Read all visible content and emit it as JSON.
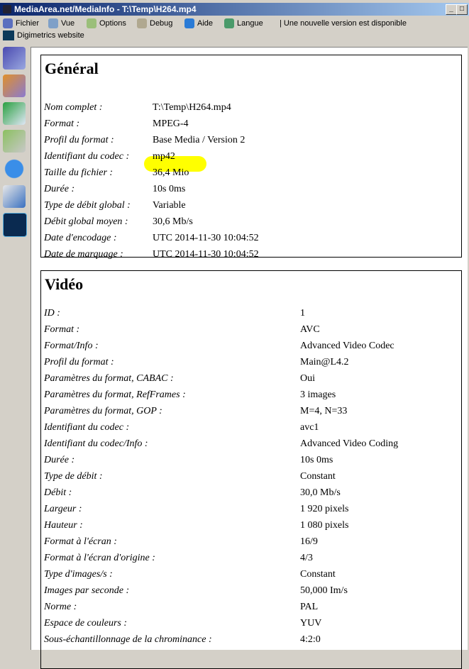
{
  "window": {
    "title": "MediaArea.net/MediaInfo - T:\\Temp\\H264.mp4",
    "minimize": "_",
    "maximize": "□"
  },
  "menu": [
    {
      "label": "Fichier",
      "icon": "file-icon",
      "color": "#5b6fbf"
    },
    {
      "label": "Vue",
      "icon": "view-icon",
      "color": "#7fa0c8"
    },
    {
      "label": "Options",
      "icon": "options-icon",
      "color": "#9bbf7a"
    },
    {
      "label": "Debug",
      "icon": "debug-icon",
      "color": "#b0a890"
    },
    {
      "label": "Aide",
      "icon": "help-icon",
      "color": "#2a7bd6"
    },
    {
      "label": "Langue",
      "icon": "globe-icon",
      "color": "#4a9a6a"
    }
  ],
  "update_notice": "| Une nouvelle version est disponible",
  "digimetrics": "Digimetrics website",
  "general": {
    "title": "Général",
    "rows": [
      [
        "Nom complet :",
        "T:\\Temp\\H264.mp4"
      ],
      [
        "Format :",
        "MPEG-4"
      ],
      [
        "Profil du format :",
        "Base Media / Version 2"
      ],
      [
        "Identifiant du codec :",
        "mp42"
      ],
      [
        "Taille du fichier :",
        "36,4 Mio"
      ],
      [
        "Durée :",
        "10s 0ms"
      ],
      [
        "Type de débit global :",
        "Variable"
      ],
      [
        "Débit global moyen :",
        "30,6 Mb/s"
      ],
      [
        "Date d'encodage :",
        "UTC 2014-11-30 10:04:52"
      ],
      [
        "Date de marquage :",
        "UTC 2014-11-30 10:04:52"
      ]
    ]
  },
  "video": {
    "title": "Vidéo",
    "rows": [
      [
        "ID :",
        "1"
      ],
      [
        "Format :",
        "AVC"
      ],
      [
        "Format/Info :",
        "Advanced Video Codec"
      ],
      [
        "Profil du format :",
        "Main@L4.2"
      ],
      [
        "Paramètres du format, CABAC :",
        "Oui"
      ],
      [
        "Paramètres du format, RefFrames :",
        "3 images"
      ],
      [
        "Paramètres du format, GOP :",
        "M=4, N=33"
      ],
      [
        "Identifiant du codec :",
        "avc1"
      ],
      [
        "Identifiant du codec/Info :",
        "Advanced Video Coding"
      ],
      [
        "Durée :",
        "10s 0ms"
      ],
      [
        "Type de débit :",
        "Constant"
      ],
      [
        "Débit :",
        "30,0 Mb/s"
      ],
      [
        "Largeur :",
        "1 920 pixels"
      ],
      [
        "Hauteur :",
        "1 080 pixels"
      ],
      [
        "Format à l'écran :",
        "16/9"
      ],
      [
        "Format à l'écran d'origine :",
        "4/3"
      ],
      [
        "Type d'images/s :",
        "Constant"
      ],
      [
        "Images par seconde :",
        "50,000 Im/s"
      ],
      [
        "Norme :",
        "PAL"
      ],
      [
        "Espace de couleurs :",
        "YUV"
      ],
      [
        "Sous-échantillonnage de la chrominance :",
        "4:2:0"
      ]
    ]
  }
}
